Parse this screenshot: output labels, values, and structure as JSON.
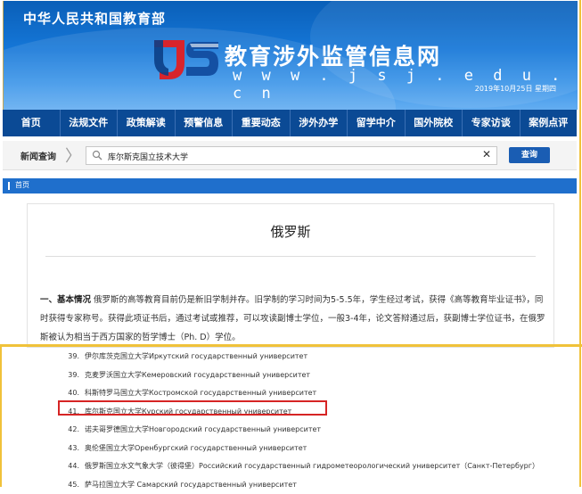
{
  "header": {
    "ministry": "中华人民共和国教育部",
    "site_title": "教育涉外监管信息网",
    "site_url": "w w w . j s j . e d u . c n",
    "date": "2019年10月25日 星期四"
  },
  "nav": [
    "首页",
    "法规文件",
    "政策解读",
    "预警信息",
    "重要动态",
    "涉外办学",
    "留学中介",
    "国外院校",
    "专家访谈",
    "案例点评"
  ],
  "search": {
    "label": "新闻查询",
    "value": "库尔斯克国立技术大学",
    "button": "查询"
  },
  "breadcrumb": "首页",
  "content": {
    "country": "俄罗斯",
    "intro_heading": "一、基本情况",
    "intro_text": "俄罗斯的高等教育目前仍是新旧学制并存。旧学制的学习时间为5-5.5年，学生经过考试，获得《高等教育毕业证书》，同时获得专家称号。获得此项证书后，通过考试或推荐，可以攻读副博士学位，一般3-4年，论文答辩通过后，获副博士学位证书，在俄罗斯被认为相当于西方国家的哲学博士（Ph. D）学位。"
  },
  "universities": [
    {
      "num": "39.",
      "name": "伊尔库茨克国立大学Иркутский государственный университет"
    },
    {
      "num": "39.",
      "name": "克麦罗沃国立大学Кемеровский государственный университет"
    },
    {
      "num": "40.",
      "name": "科斯特罗马国立大学Костромской государственный университет"
    },
    {
      "num": "41.",
      "name": "库尔斯克国立大学Курский государственный университет"
    },
    {
      "num": "42.",
      "name": "诺夫哥罗德国立大学Новгородский государственный университет"
    },
    {
      "num": "43.",
      "name": "奥伦堡国立大学Оренбургский государственный университет"
    },
    {
      "num": "44.",
      "name": "俄罗斯国立水文气象大学（彼得堡）Российский государственный гидрометеорологический университет（Санкт-Петербург）"
    },
    {
      "num": "45.",
      "name": "萨马拉国立大学 Самарский государственный университет"
    }
  ]
}
